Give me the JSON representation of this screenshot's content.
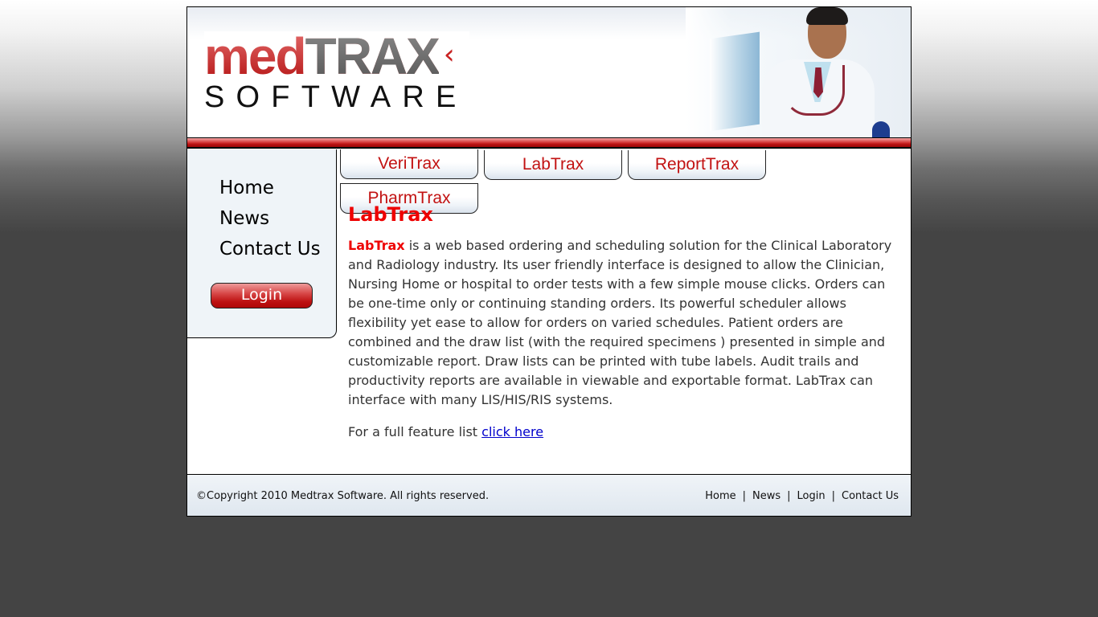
{
  "header": {
    "logo": {
      "med": "med",
      "trax": "TRAX",
      "software": "SOFTWARE"
    },
    "banner_image": "doctor-at-computer"
  },
  "product_tabs": [
    {
      "label": "VeriTrax"
    },
    {
      "label": "LabTrax"
    },
    {
      "label": "ReportTrax"
    },
    {
      "label": "PharmTrax"
    }
  ],
  "sidebar": {
    "items": [
      {
        "label": "Home"
      },
      {
        "label": "News"
      },
      {
        "label": "Contact Us"
      }
    ],
    "login_label": "Login"
  },
  "content": {
    "title": "LabTrax",
    "brand_word": "LabTrax",
    "description": " is a web based ordering and scheduling solution for the Clinical Laboratory and Radiology industry. Its user friendly interface is designed to allow the Clinician, Nursing Home or hospital to order tests with a few simple mouse clicks. Orders can be one-time only or continuing standing orders. Its powerful scheduler allows flexibility yet ease to allow for orders on varied schedules. Patient orders are combined and the draw list (with the required specimens ) presented in simple and customizable report. Draw lists can be printed with tube labels. Audit trails and productivity reports are available in viewable and exportable format. LabTrax can interface with many LIS/HIS/RIS systems.",
    "feature_prefix": "For a full feature list ",
    "feature_link": "click here"
  },
  "footer": {
    "copyright": "©Copyright 2010 Medtrax Software. All rights reserved.",
    "links": [
      {
        "label": "Home"
      },
      {
        "label": "News"
      },
      {
        "label": "Login"
      },
      {
        "label": "Contact Us"
      }
    ],
    "separator": "|"
  },
  "colors": {
    "brand_red": "#e00000",
    "tab_text": "#c21212",
    "link_blue": "#0000cc",
    "page_bg_dark": "#444444"
  }
}
